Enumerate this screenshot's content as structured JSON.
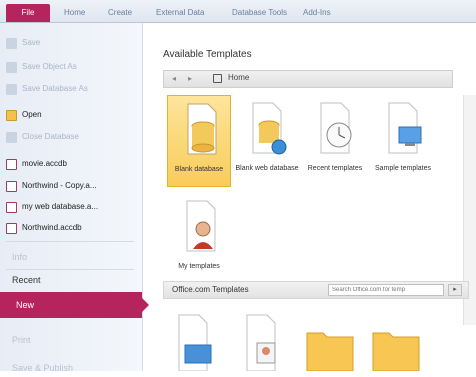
{
  "ribbon": {
    "tabs": [
      "File",
      "Home",
      "Create",
      "External Data",
      "Database Tools",
      "Add-Ins"
    ]
  },
  "backstage": {
    "menu_top": [
      "Save",
      "Save Object As",
      "Save Database As",
      "Open",
      "Close Database"
    ],
    "recent_files": [
      "movie.accdb",
      "Northwind - Copy.a...",
      "my web database.a...",
      "Northwind.accdb"
    ],
    "sections": [
      "Info",
      "Recent",
      "New",
      "Print",
      "Save & Publish"
    ]
  },
  "available_templates": {
    "title": "Available Templates",
    "nav": {
      "back": "◂",
      "forward": "▸",
      "home_label": "Home"
    },
    "tiles": [
      {
        "label": "Blank database",
        "icon": "blank-database-icon",
        "selected": true
      },
      {
        "label": "Blank web database",
        "icon": "blank-web-database-icon",
        "selected": false
      },
      {
        "label": "Recent templates",
        "icon": "recent-templates-icon",
        "selected": false
      },
      {
        "label": "Sample templates",
        "icon": "sample-templates-icon",
        "selected": false
      },
      {
        "label": "My templates",
        "icon": "my-templates-icon",
        "selected": false
      }
    ]
  },
  "office_templates": {
    "title": "Office.com Templates",
    "search_placeholder": "Search Office.com for temp",
    "go": "▸"
  },
  "colors": {
    "accent": "#b5245c",
    "selected_tile": "#f8cc5a"
  }
}
